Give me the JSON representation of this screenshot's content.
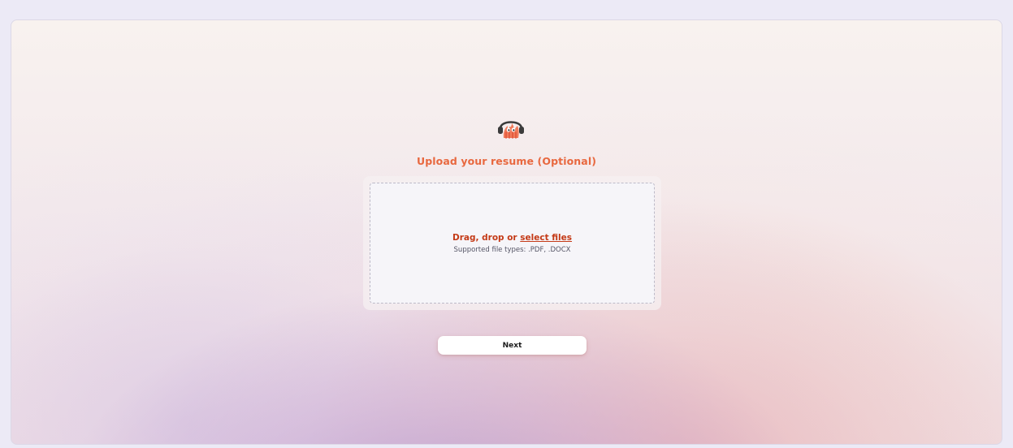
{
  "upload": {
    "title": "Upload your resume (Optional)",
    "drop_prefix": "Drag, drop or ",
    "select_link": "select files",
    "supported_types": "Supported file types: .PDF, .DOCX"
  },
  "actions": {
    "next_label": "Next"
  },
  "colors": {
    "accent_orange": "#e8683f",
    "link_red": "#c43a17",
    "logo_orange": "#f07a5a"
  },
  "icons": {
    "logo": "headphones-mascot-icon"
  }
}
